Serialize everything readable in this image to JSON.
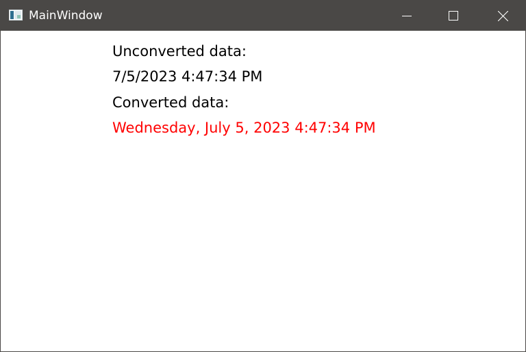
{
  "window": {
    "title": "MainWindow",
    "titlebar_color": "#4a4846",
    "icons": {
      "app": "app-window-icon",
      "minimize": "minimize-icon",
      "maximize": "maximize-icon",
      "close": "close-icon"
    }
  },
  "content": {
    "unconverted_label": "Unconverted data:",
    "unconverted_value": "7/5/2023 4:47:34 PM",
    "converted_label": "Converted data:",
    "converted_value": "Wednesday, July 5, 2023 4:47:34 PM",
    "text_color": "#000000",
    "converted_color": "#ff0000"
  }
}
